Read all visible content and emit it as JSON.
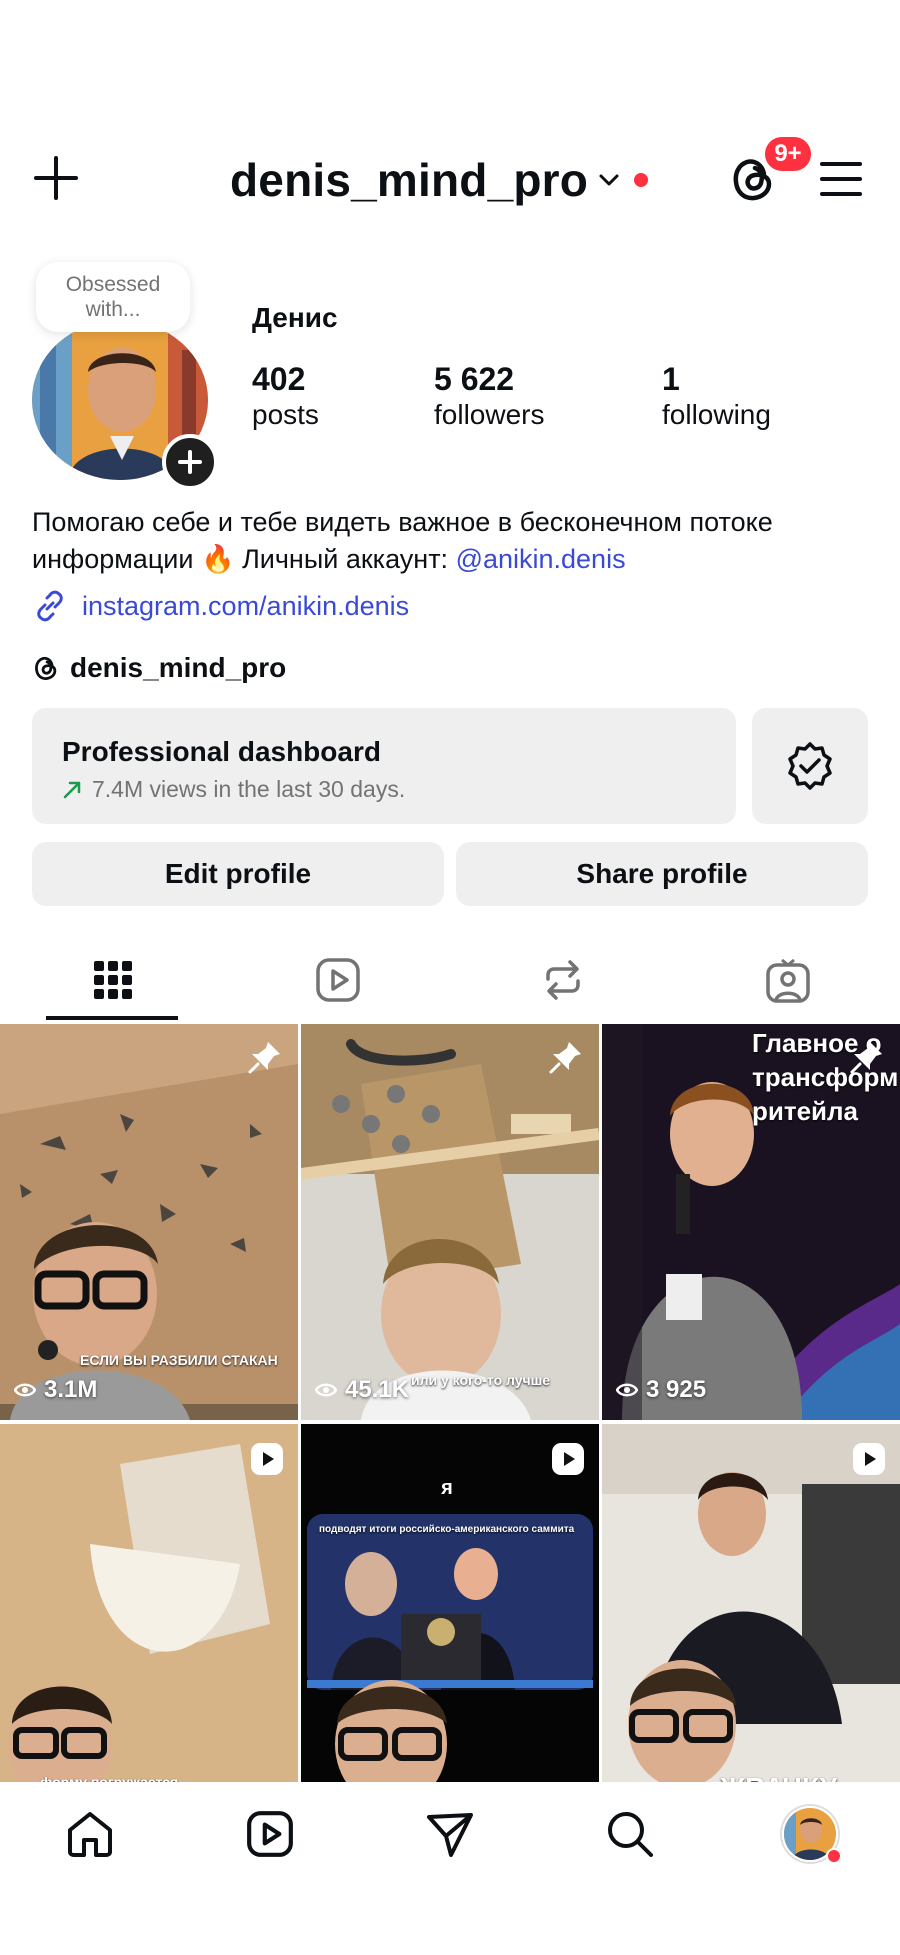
{
  "header": {
    "username": "denis_mind_pro",
    "notification_badge": "9+"
  },
  "profile": {
    "note": "Obsessed with...",
    "display_name": "Денис",
    "stats": [
      {
        "value": "402",
        "label": "posts"
      },
      {
        "value": "5 622",
        "label": "followers"
      },
      {
        "value": "1",
        "label": "following"
      }
    ],
    "bio_line1": "Помогаю себе и тебе видеть важное в бесконечном потоке",
    "bio_line2": "информации 🔥 Личный аккаунт: ",
    "bio_mention": "@anikin.denis",
    "link": "instagram.com/anikin.denis",
    "threads_handle": "denis_mind_pro"
  },
  "dashboard": {
    "title": "Professional dashboard",
    "subtitle": "7.4M views in the last 30 days."
  },
  "buttons": {
    "edit": "Edit profile",
    "share": "Share profile"
  },
  "tabs": [
    "grid-icon",
    "reels-icon",
    "reposts-icon",
    "tagged-icon"
  ],
  "grid": [
    {
      "views": "3.1M",
      "caption": "ЕСЛИ ВЫ РАЗБИЛИ СТАКАН",
      "badge": "pin-icon"
    },
    {
      "views": "45.1K",
      "caption": "или у кого-то лучше",
      "badge": "pin-icon"
    },
    {
      "views": "3 925",
      "caption": "Главное о трансформ ритейла",
      "badge": "pin-icon"
    },
    {
      "views": "",
      "caption": "форму погружается",
      "badge": "reel-icon"
    },
    {
      "views": "",
      "caption": "подводят итоги российско-американского саммита",
      "badge": "reel-icon"
    },
    {
      "views": "",
      "caption": "ЖВАЧКУ",
      "badge": "reel-icon"
    }
  ],
  "bottom_nav": [
    "home-icon",
    "reels-icon",
    "messages-icon",
    "search-icon",
    "profile-avatar"
  ],
  "colors": {
    "accent_link": "#3a4ad6",
    "badge_red": "#ff3040",
    "surface": "#efefef"
  }
}
